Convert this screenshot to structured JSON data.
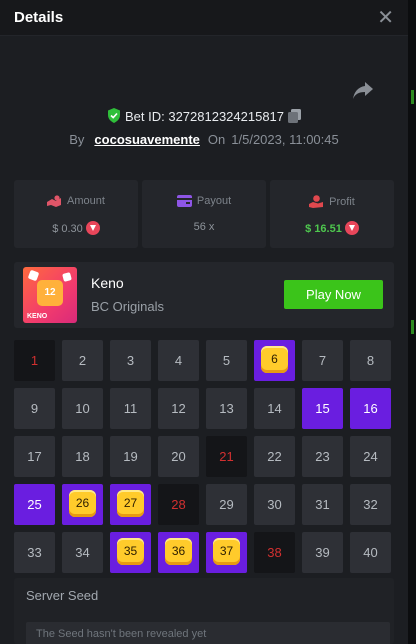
{
  "header": {
    "title": "Details",
    "close_icon": "close-icon"
  },
  "bet": {
    "id_text": "Bet ID: 3272812324215817",
    "by_label": "By",
    "user": "cocosuavemente",
    "on_label": "On",
    "datetime": "1/5/2023, 11:00:45"
  },
  "stats": {
    "amount": {
      "label": "Amount",
      "value": "$ 0.30"
    },
    "payout": {
      "label": "Payout",
      "value": "56 x"
    },
    "profit": {
      "label": "Profit",
      "value": "$ 16.51"
    }
  },
  "game": {
    "name": "Keno",
    "provider": "BC Originals",
    "play_label": "Play Now",
    "thumb_number": "12",
    "thumb_text": "KENO"
  },
  "grid": {
    "cells": [
      {
        "n": "1",
        "s": "dark"
      },
      {
        "n": "2",
        "s": ""
      },
      {
        "n": "3",
        "s": ""
      },
      {
        "n": "4",
        "s": ""
      },
      {
        "n": "5",
        "s": ""
      },
      {
        "n": "6",
        "s": "hit"
      },
      {
        "n": "7",
        "s": ""
      },
      {
        "n": "8",
        "s": ""
      },
      {
        "n": "9",
        "s": ""
      },
      {
        "n": "10",
        "s": ""
      },
      {
        "n": "11",
        "s": ""
      },
      {
        "n": "12",
        "s": ""
      },
      {
        "n": "13",
        "s": ""
      },
      {
        "n": "14",
        "s": ""
      },
      {
        "n": "15",
        "s": "sel"
      },
      {
        "n": "16",
        "s": "sel"
      },
      {
        "n": "17",
        "s": ""
      },
      {
        "n": "18",
        "s": ""
      },
      {
        "n": "19",
        "s": ""
      },
      {
        "n": "20",
        "s": ""
      },
      {
        "n": "21",
        "s": "dark"
      },
      {
        "n": "22",
        "s": ""
      },
      {
        "n": "23",
        "s": ""
      },
      {
        "n": "24",
        "s": ""
      },
      {
        "n": "25",
        "s": "sel"
      },
      {
        "n": "26",
        "s": "hit"
      },
      {
        "n": "27",
        "s": "hit"
      },
      {
        "n": "28",
        "s": "dark"
      },
      {
        "n": "29",
        "s": ""
      },
      {
        "n": "30",
        "s": ""
      },
      {
        "n": "31",
        "s": ""
      },
      {
        "n": "32",
        "s": ""
      },
      {
        "n": "33",
        "s": ""
      },
      {
        "n": "34",
        "s": ""
      },
      {
        "n": "35",
        "s": "hit"
      },
      {
        "n": "36",
        "s": "hit"
      },
      {
        "n": "37",
        "s": "hit"
      },
      {
        "n": "38",
        "s": "dark"
      },
      {
        "n": "39",
        "s": ""
      },
      {
        "n": "40",
        "s": ""
      }
    ]
  },
  "seed": {
    "label": "Server Seed",
    "placeholder": "The Seed hasn't been revealed yet"
  },
  "colors": {
    "accent_purple": "#6a1ee0",
    "play_green": "#3bc41a",
    "profit_green": "#4ec74e",
    "miss_red": "#d23030"
  }
}
